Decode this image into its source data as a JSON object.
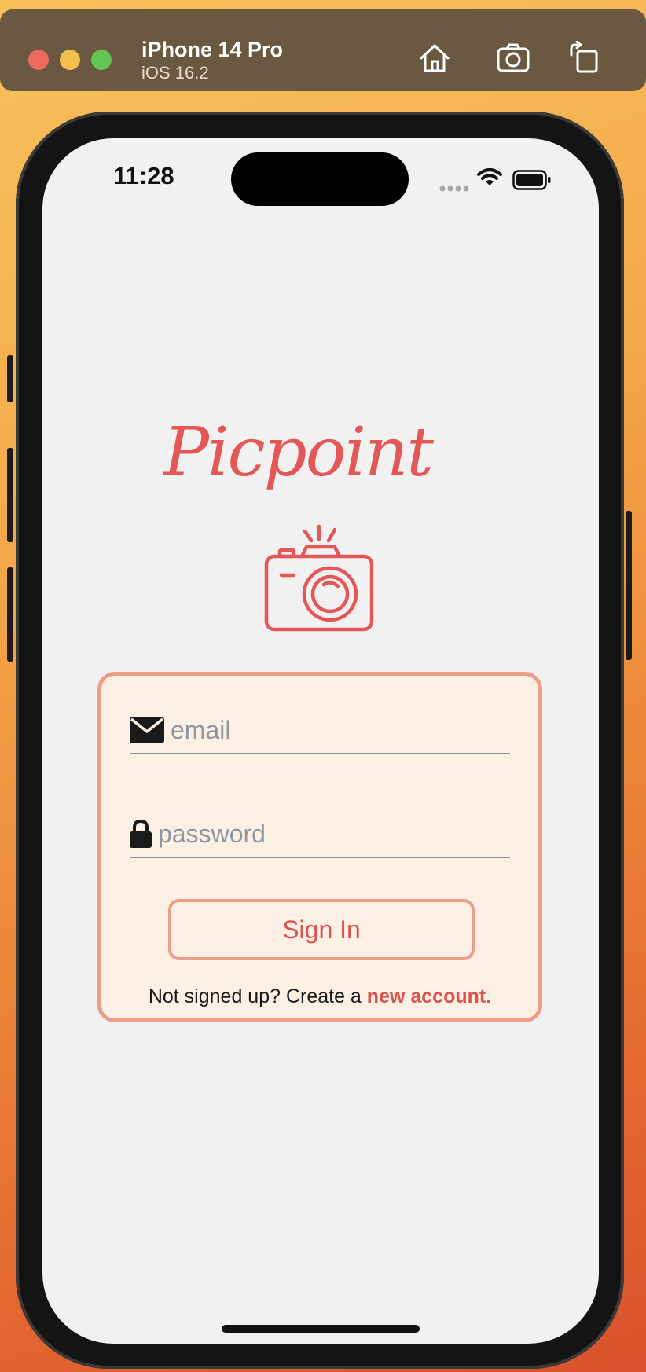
{
  "simulator": {
    "device_name": "iPhone 14 Pro",
    "os_version": "iOS 16.2",
    "toolbar_icons": [
      "home-icon",
      "screenshot-icon",
      "rotate-icon"
    ]
  },
  "status_bar": {
    "time": "11:28",
    "icons": [
      "cellular-signal-icon",
      "wifi-icon",
      "battery-icon"
    ]
  },
  "app": {
    "brand_name": "Picpoint",
    "logo_icon": "camera-icon",
    "colors": {
      "accent": "#e45757",
      "card_border": "#ee9d8b",
      "card_background": "#fcf0e4",
      "screen_background": "#f2f1f2"
    }
  },
  "login_form": {
    "email": {
      "value": "",
      "placeholder": "email",
      "icon": "envelope-icon"
    },
    "password": {
      "value": "",
      "placeholder": "password",
      "icon": "lock-icon"
    },
    "signin_label": "Sign In",
    "signup_prompt": "Not signed up? Create a",
    "signup_link": "new account."
  }
}
